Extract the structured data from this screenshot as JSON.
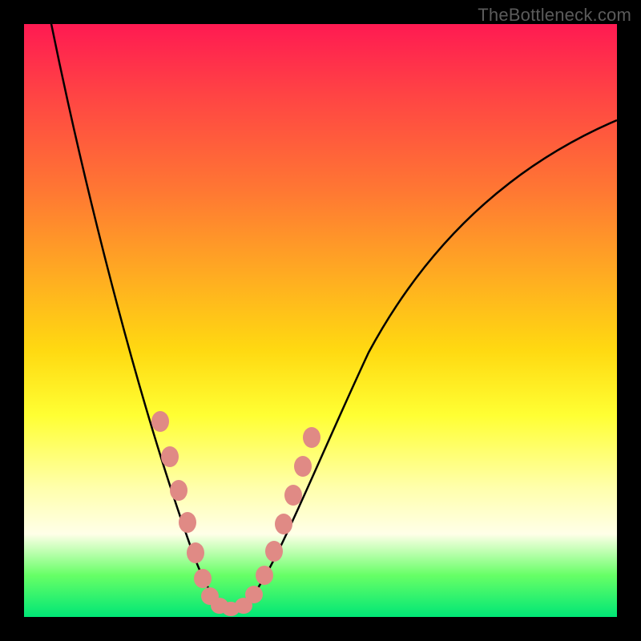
{
  "watermark": "TheBottleneck.com",
  "chart_data": {
    "type": "line",
    "title": "",
    "xlabel": "",
    "ylabel": "",
    "xlim": [
      0,
      100
    ],
    "ylim": [
      0,
      100
    ],
    "series": [
      {
        "name": "bottleneck-curve",
        "x": [
          5,
          10,
          15,
          20,
          25,
          28,
          30,
          32,
          34,
          38,
          42,
          50,
          60,
          70,
          80,
          90,
          100
        ],
        "values": [
          100,
          80,
          60,
          40,
          20,
          10,
          4,
          1,
          1,
          5,
          15,
          35,
          55,
          68,
          77,
          83,
          88
        ]
      }
    ],
    "dot_clusters": [
      {
        "name": "left-cluster",
        "points": [
          {
            "x": 22,
            "y": 33
          },
          {
            "x": 23.5,
            "y": 27
          },
          {
            "x": 25,
            "y": 21
          },
          {
            "x": 26.5,
            "y": 15
          },
          {
            "x": 28,
            "y": 10
          },
          {
            "x": 29,
            "y": 6
          },
          {
            "x": 30,
            "y": 3
          },
          {
            "x": 31.5,
            "y": 1.5
          },
          {
            "x": 33,
            "y": 1
          }
        ]
      },
      {
        "name": "right-cluster",
        "points": [
          {
            "x": 35,
            "y": 1.5
          },
          {
            "x": 36.5,
            "y": 3.5
          },
          {
            "x": 38,
            "y": 7
          },
          {
            "x": 39.5,
            "y": 11
          },
          {
            "x": 41,
            "y": 16
          },
          {
            "x": 42.5,
            "y": 21
          },
          {
            "x": 44,
            "y": 26
          },
          {
            "x": 45.5,
            "y": 31
          }
        ]
      }
    ],
    "colors": {
      "curve": "#000000",
      "dots": "#e08a85"
    }
  }
}
